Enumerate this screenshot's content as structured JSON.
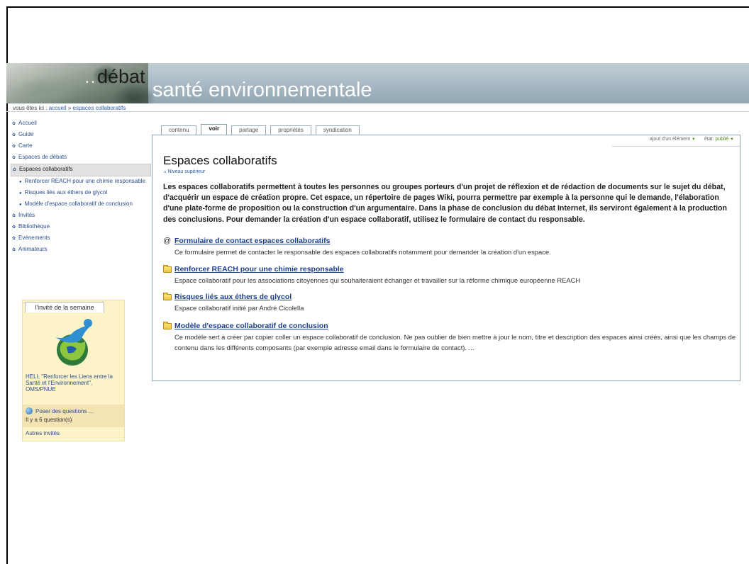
{
  "banner": {
    "logo_left": "débat",
    "logo_right": "santé environnementale",
    "dots": "• •"
  },
  "breadcrumb": {
    "prefix": "vous êtes ici :",
    "home": "accueil",
    "sep": "»",
    "current": "espaces collaboratifs"
  },
  "nav": {
    "items": [
      {
        "label": "Accueil"
      },
      {
        "label": "Guide"
      },
      {
        "label": "Carte"
      },
      {
        "label": "Espaces de débats"
      },
      {
        "label": "Espaces collaboratifs"
      }
    ],
    "sub": [
      {
        "label": "Renforcer REACH pour une chimie responsable"
      },
      {
        "label": "Risques liés aux éthers de glycol"
      },
      {
        "label": "Modèle d'espace collaboratif de conclusion"
      }
    ],
    "items_after": [
      {
        "label": "Invités"
      },
      {
        "label": "Bibliothèque"
      },
      {
        "label": "Evénements"
      },
      {
        "label": "Animateurs"
      }
    ]
  },
  "guest": {
    "tab": "l'invité de la semaine",
    "caption": "HELI, \"Renforcer les Liens entre la Santé et l'Environnement\", OMS/PNUE",
    "ask": "Poser des questions ...",
    "count": "Il y a 6 question(s)",
    "others": "Autres invités"
  },
  "tabs": [
    "contenu",
    "voir",
    "partage",
    "propriétés",
    "syndication"
  ],
  "actions": {
    "add": "ajout d'un élément",
    "state_label": "état:",
    "state_value": "publié"
  },
  "main": {
    "title": "Espaces collaboratifs",
    "up": "Niveau supérieur",
    "intro": "Les espaces collaboratifs permettent à toutes les personnes ou groupes porteurs d'un projet de réflexion et de rédaction de documents sur le sujet du débat, d'acquérir un espace de création propre. Cet espace, un répertoire de pages Wiki, pourra permettre par exemple à la personne qui le demande, l'élaboration d'une plate-forme de proposition ou la construction d'un argumentaire. Dans la phase de conclusion du débat Internet, ils serviront également à la production des conclusions. Pour demander la création d'un espace collaboratif, utilisez le formulaire de contact du responsable.",
    "entries": [
      {
        "icon": "at-icon",
        "title": "Formulaire de contact espaces collaboratifs",
        "desc": "Ce formulaire permet de contacter le responsable des espaces collaboratifs notamment pour demander la création d'un espace."
      },
      {
        "icon": "folder-icon",
        "title": "Renforcer REACH pour une chimie responsable",
        "desc": "Espace collaboratif pour les associations citoyennes qui souhaiteraient échanger et travailler sur la réforme chimique européenne REACH"
      },
      {
        "icon": "folder-icon",
        "title": "Risques liés aux éthers de glycol",
        "desc": "Espace collaboratif initié par André Cicolella"
      },
      {
        "icon": "folder-icon",
        "title": "Modèle d'espace collaboratif de conclusion",
        "desc": "Ce modèle sert à créer par copier coller un espace collaboratif de conclusion. Ne pas oublier de bien mettre à jour le nom, titre et description des espaces ainsi créés, ainsi que les champs de contenu dans les différents composants (par exemple adresse email dans le formulaire de contact). ..."
      }
    ]
  }
}
